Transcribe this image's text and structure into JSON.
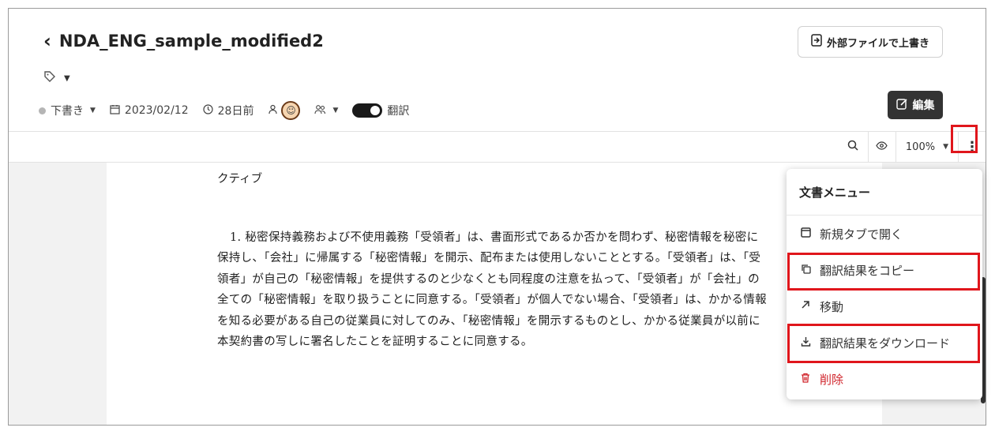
{
  "header": {
    "back_icon": "chevron-left-icon",
    "title": "NDA_ENG_sample_modified2",
    "overwrite_button": "外部ファイルで上書き",
    "tag_icon": "tag-icon",
    "status": "下書き",
    "date": "2023/02/12",
    "relative_time": "28日前",
    "translate_toggle_label": "翻訳",
    "edit_button": "編集"
  },
  "toolbar": {
    "zoom": "100%"
  },
  "document": {
    "heading_fragment": "クティブ",
    "paragraph": "1. 秘密保持義務および不使用義務「受領者」は、書面形式であるか否かを問わず、秘密情報を秘密に保持し、「会社」に帰属する「秘密情報」を開示、配布または使用しないこととする。「受領者」は、「受領者」が自己の「秘密情報」を提供するのと少なくとも同程度の注意を払って、「受領者」が「会社」の全ての「秘密情報」を取り扱うことに同意する。「受領者」が個人でない場合、「受領者」は、かかる情報を知る必要がある自己の従業員に対してのみ、「秘密情報」を開示するものとし、かかる従業員が以前に本契約書の写しに署名したことを証明することに同意する。"
  },
  "menu": {
    "title": "文書メニュー",
    "items": [
      {
        "label": "新規タブで開く",
        "icon": "new-tab-icon"
      },
      {
        "label": "翻訳結果をコピー",
        "icon": "copy-icon"
      },
      {
        "label": "移動",
        "icon": "move-arrow-icon"
      },
      {
        "label": "翻訳結果をダウンロード",
        "icon": "download-icon"
      },
      {
        "label": "削除",
        "icon": "trash-icon"
      }
    ]
  },
  "colors": {
    "highlight": "#e0161c",
    "danger": "#d0242b",
    "dark_button": "#333333"
  }
}
